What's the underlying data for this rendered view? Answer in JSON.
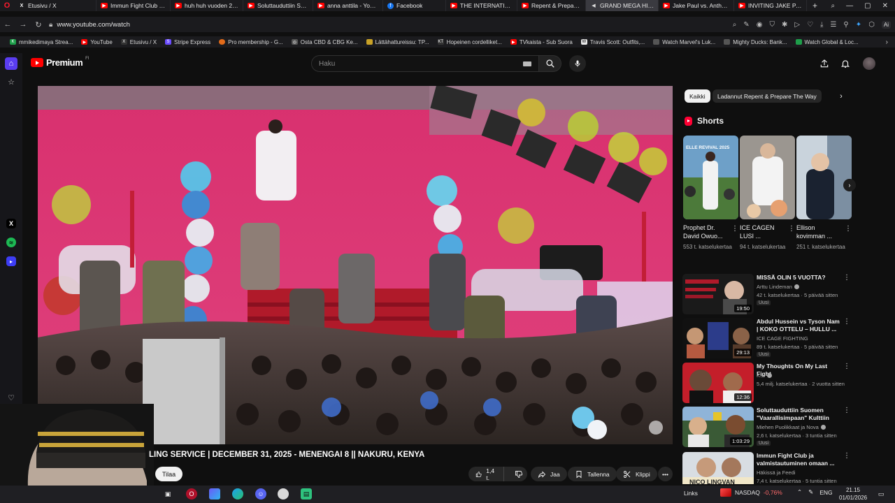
{
  "browser": {
    "tabs": [
      {
        "icon": "x-icon",
        "title": "Etusivu / X",
        "active": false
      },
      {
        "icon": "youtube-icon",
        "title": "Immun Fight Club ja v",
        "active": false
      },
      {
        "icon": "youtube-icon",
        "title": "huh huh vuoden 2026",
        "active": false
      },
      {
        "icon": "youtube-icon",
        "title": "Soluttauduttiin Suome",
        "active": false
      },
      {
        "icon": "youtube-icon",
        "title": "anna anttila - YouTube",
        "active": false
      },
      {
        "icon": "facebook-icon",
        "title": "Facebook",
        "active": false
      },
      {
        "icon": "youtube-icon",
        "title": "THE INTERNATIONAL",
        "active": false
      },
      {
        "icon": "youtube-icon",
        "title": "Repent & Prepare The",
        "active": false
      },
      {
        "icon": "speaker-icon",
        "title": "GRAND MEGA HISTO",
        "active": true
      },
      {
        "icon": "youtube-icon",
        "title": "Jake Paul vs. Anthony",
        "active": false
      },
      {
        "icon": "youtube-icon",
        "title": "INVITING JAKE PAUL T",
        "active": false
      }
    ],
    "url": "www.youtube.com/watch",
    "ai_badge": "Ai",
    "bookmarks": [
      {
        "icon": "green",
        "glyph": "K",
        "label": "mmikedimaya Strea..."
      },
      {
        "icon": "red",
        "glyph": "▶",
        "label": "YouTube"
      },
      {
        "icon": "x",
        "glyph": "X",
        "label": "Etusivu / X"
      },
      {
        "icon": "purple",
        "glyph": "S",
        "label": "Stripe Express"
      },
      {
        "icon": "orange",
        "glyph": "",
        "label": "Pro membership - G..."
      },
      {
        "icon": "grey",
        "glyph": "◎",
        "label": "Osta CBD & CBG Ke..."
      },
      {
        "icon": "yellow",
        "glyph": "",
        "label": "Lättähattureissu: TP..."
      },
      {
        "icon": "dark",
        "glyph": "KT",
        "label": "Hopeinen cordelliket..."
      },
      {
        "icon": "red",
        "glyph": "▶",
        "label": "TVkaista - Sub Suora"
      },
      {
        "icon": "white",
        "glyph": "W",
        "label": "Travis Scott: Outfits,..."
      },
      {
        "icon": "grey",
        "glyph": "",
        "label": "Watch Marvel's Luk..."
      },
      {
        "icon": "grey",
        "glyph": "",
        "label": "Mighty Ducks: Bank..."
      },
      {
        "icon": "green",
        "glyph": "",
        "label": "Watch Global & Loc..."
      }
    ]
  },
  "youtube": {
    "brand": "Premium",
    "region": "FI",
    "search_placeholder": "Haku",
    "video_title": "LING SERVICE | DECEMBER 31, 2025 - MENENGAI 8 || NAKURU, KENYA",
    "subscribe_label": "Tilaa",
    "actions": {
      "likes": "1,4 t.",
      "share": "Jaa",
      "save": "Tallenna",
      "clip": "Klippi"
    },
    "chips": {
      "all": "Kaikki",
      "upload": "Ladannut Repent & Prepare The Way"
    },
    "shorts_heading": "Shorts",
    "shorts": [
      {
        "title": "Prophet Dr. David Owuo...",
        "views": "553 t. katselukertaa",
        "thumb_text": "ELLE REVIVAL 2025"
      },
      {
        "title": "ICE CAGEN LUSI ...",
        "views": "94 t. katselukertaa",
        "thumb_text": ""
      },
      {
        "title": "Ellison kovimman ...",
        "views": "251 t. katselukertaa",
        "thumb_text": ""
      }
    ],
    "recommended": [
      {
        "title": "MISSÄ OLIN 5 VUOTTA?",
        "channel": "Arttu Lindeman",
        "verified": true,
        "meta": "42 t. katselukertaa · 5 päivää sitten",
        "new": "Uusi",
        "duration": "19:50"
      },
      {
        "title": "Abdul Hussein vs Tyson Nam | KOKO OTTELU – HULLU ...",
        "channel": "ICE CAGE FIGHTING",
        "verified": false,
        "meta": "89 t. katselukertaa · 5 päivää sitten",
        "new": "Uusi",
        "duration": "29:13"
      },
      {
        "title": "My Thoughts On My Last Fight",
        "channel": "KSI",
        "verified": true,
        "meta": "5,4 milj. katselukertaa · 2 vuotta sitten",
        "new": "",
        "duration": "12:36"
      },
      {
        "title": "Soluttauduttiin Suomen \"Vaarallisimpaan\" Kulttiin",
        "channel": "Miehen Puolikkaat ja Nova",
        "verified": true,
        "meta": "2,6 t. katselukertaa · 3 tuntia sitten",
        "new": "Uusi",
        "duration": "1:03:29"
      },
      {
        "title": "Immun Fight Club ja valmistautuminen omaan ...",
        "channel": "Häkissä ja Feedi",
        "verified": false,
        "meta": "7,4 t. katselukertaa · 5 tuntia sitten",
        "new": "",
        "duration": "",
        "thumb_text": "NICO LINGVAN"
      }
    ]
  },
  "taskbar": {
    "links_label": "Links",
    "ticker_name": "NASDAQ",
    "ticker_change": "-0,76%",
    "language": "ENG",
    "time": "21.15",
    "date": "01/01/2026"
  },
  "colors": {
    "yt_red": "#ff0000",
    "opera_red": "#ff1b2d",
    "bg": "#0f0f0f",
    "chip_active": "#f1f1f1"
  }
}
